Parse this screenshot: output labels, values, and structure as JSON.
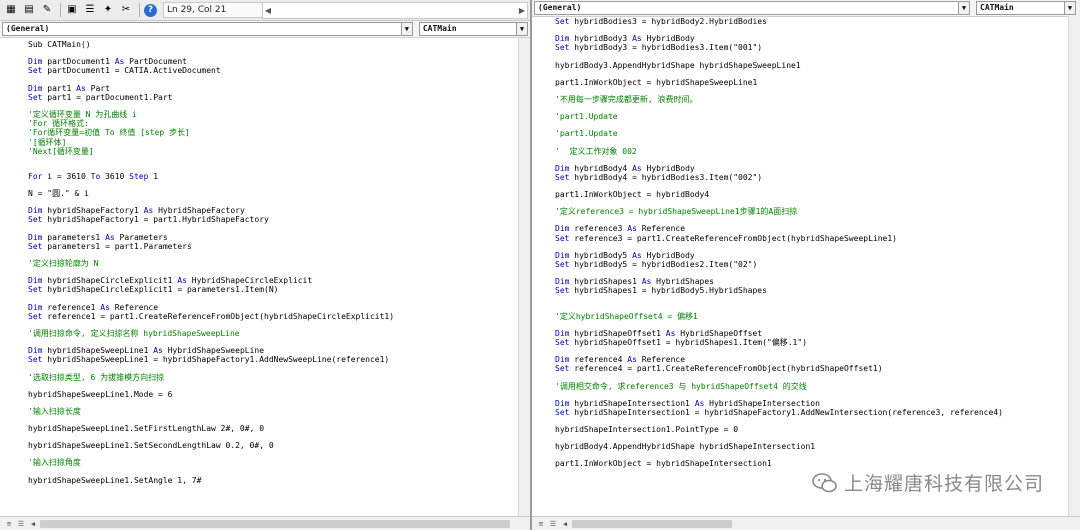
{
  "left": {
    "toolbar": {
      "position": "Ln 29, Col 21"
    },
    "object_combo": "(General)",
    "proc_combo": "CATMain",
    "lines": [
      [
        {
          "t": "Sub CATMain()"
        }
      ],
      [],
      [
        {
          "t": "Dim",
          "c": "kw"
        },
        {
          "t": " partDocument1 "
        },
        {
          "t": "As",
          "c": "kw"
        },
        {
          "t": " PartDocument"
        }
      ],
      [
        {
          "t": "Set",
          "c": "kw"
        },
        {
          "t": " partDocument1 = CATIA.ActiveDocument"
        }
      ],
      [],
      [
        {
          "t": "Dim",
          "c": "kw"
        },
        {
          "t": " part1 "
        },
        {
          "t": "As",
          "c": "kw"
        },
        {
          "t": " Part"
        }
      ],
      [
        {
          "t": "Set",
          "c": "kw"
        },
        {
          "t": " part1 = partDocument1.Part"
        }
      ],
      [],
      [
        {
          "t": "'定义循环变量 N 为孔曲线 i",
          "c": "cm"
        }
      ],
      [
        {
          "t": "'For 循环格式:",
          "c": "cm"
        }
      ],
      [
        {
          "t": "'For循环变量=初值 To 终值 [step 步长]",
          "c": "cm"
        }
      ],
      [
        {
          "t": "'[循环体]",
          "c": "cm"
        }
      ],
      [
        {
          "t": "'Next[循环变量]",
          "c": "cm"
        }
      ],
      [],
      [],
      [
        {
          "t": "For",
          "c": "kw"
        },
        {
          "t": " i = 3610 "
        },
        {
          "t": "To",
          "c": "kw"
        },
        {
          "t": " 3610 "
        },
        {
          "t": "Step",
          "c": "kw"
        },
        {
          "t": " 1"
        }
      ],
      [],
      [
        {
          "t": "N = \"圆.\" & i"
        }
      ],
      [],
      [
        {
          "t": "Dim",
          "c": "kw"
        },
        {
          "t": " hybridShapeFactory1 "
        },
        {
          "t": "As",
          "c": "kw"
        },
        {
          "t": " HybridShapeFactory"
        }
      ],
      [
        {
          "t": "Set",
          "c": "kw"
        },
        {
          "t": " hybridShapeFactory1 = part1.HybridShapeFactory"
        }
      ],
      [],
      [
        {
          "t": "Dim",
          "c": "kw"
        },
        {
          "t": " parameters1 "
        },
        {
          "t": "As",
          "c": "kw"
        },
        {
          "t": " Parameters"
        }
      ],
      [
        {
          "t": "Set",
          "c": "kw"
        },
        {
          "t": " parameters1 = part1.Parameters"
        }
      ],
      [],
      [
        {
          "t": "'定义扫掠轮廓为 N",
          "c": "cm"
        }
      ],
      [],
      [
        {
          "t": "Dim",
          "c": "kw"
        },
        {
          "t": " hybridShapeCircleExplicit1 "
        },
        {
          "t": "As",
          "c": "kw"
        },
        {
          "t": " HybridShapeCircleExplicit"
        }
      ],
      [
        {
          "t": "Set",
          "c": "kw"
        },
        {
          "t": " hybridShapeCircleExplicit1 = parameters1.Item(N)"
        }
      ],
      [],
      [
        {
          "t": "Dim",
          "c": "kw"
        },
        {
          "t": " reference1 "
        },
        {
          "t": "As",
          "c": "kw"
        },
        {
          "t": " Reference"
        }
      ],
      [
        {
          "t": "Set",
          "c": "kw"
        },
        {
          "t": " reference1 = part1.CreateReferenceFromObject(hybridShapeCircleExplicit1)"
        }
      ],
      [],
      [
        {
          "t": "'调用扫掠命令, 定义扫掠名称 hybridShapeSweepLine",
          "c": "cm"
        }
      ],
      [],
      [
        {
          "t": "Dim",
          "c": "kw"
        },
        {
          "t": " hybridShapeSweepLine1 "
        },
        {
          "t": "As",
          "c": "kw"
        },
        {
          "t": " HybridShapeSweepLine"
        }
      ],
      [
        {
          "t": "Set",
          "c": "kw"
        },
        {
          "t": " hybridShapeSweepLine1 = hybridShapeFactory1.AddNewSweepLine(reference1)"
        }
      ],
      [],
      [
        {
          "t": "'选取扫掠类型, 6 为拔锥模方向扫掠",
          "c": "cm"
        }
      ],
      [],
      [
        {
          "t": "hybridShapeSweepLine1.Mode = 6"
        }
      ],
      [],
      [
        {
          "t": "'输入扫掠长度",
          "c": "cm"
        }
      ],
      [],
      [
        {
          "t": "hybridShapeSweepLine1.SetFirstLengthLaw 2#, 0#, 0"
        }
      ],
      [],
      [
        {
          "t": "hybridShapeSweepLine1.SetSecondLengthLaw 0.2, 0#, 0"
        }
      ],
      [],
      [
        {
          "t": "'输入扫掠角度",
          "c": "cm"
        }
      ],
      [],
      [
        {
          "t": "hybridShapeSweepLine1.SetAngle 1, 7#"
        }
      ]
    ]
  },
  "right": {
    "object_combo": "(General)",
    "proc_combo": "CATMain",
    "lines": [
      [
        {
          "t": "Set",
          "c": "kw"
        },
        {
          "t": " hybridBodies3 = hybridBody2.HybridBodies"
        }
      ],
      [],
      [
        {
          "t": "Dim",
          "c": "kw"
        },
        {
          "t": " hybridBody3 "
        },
        {
          "t": "As",
          "c": "kw"
        },
        {
          "t": " HybridBody"
        }
      ],
      [
        {
          "t": "Set",
          "c": "kw"
        },
        {
          "t": " hybridBody3 = hybridBodies3.Item(\"001\")"
        }
      ],
      [],
      [
        {
          "t": "hybridBody3.AppendHybridShape hybridShapeSweepLine1"
        }
      ],
      [],
      [
        {
          "t": "part1.InWorkObject = hybridShapeSweepLine1"
        }
      ],
      [],
      [
        {
          "t": "'不用每一步骤完成都更新, 浪费时间。",
          "c": "cm"
        }
      ],
      [],
      [
        {
          "t": "'part1.Update",
          "c": "cm"
        }
      ],
      [],
      [
        {
          "t": "'part1.Update",
          "c": "cm"
        }
      ],
      [],
      [
        {
          "t": "'  定义工作对象 002",
          "c": "cm"
        }
      ],
      [],
      [
        {
          "t": "Dim",
          "c": "kw"
        },
        {
          "t": " hybridBody4 "
        },
        {
          "t": "As",
          "c": "kw"
        },
        {
          "t": " HybridBody"
        }
      ],
      [
        {
          "t": "Set",
          "c": "kw"
        },
        {
          "t": " hybridBody4 = hybridBodies3.Item(\"002\")"
        }
      ],
      [],
      [
        {
          "t": "part1.InWorkObject = hybridBody4"
        }
      ],
      [],
      [
        {
          "t": "'定义reference3 = hybridShapeSweepLine1步骤1的A面扫掠",
          "c": "cm"
        }
      ],
      [],
      [
        {
          "t": "Dim",
          "c": "kw"
        },
        {
          "t": " reference3 "
        },
        {
          "t": "As",
          "c": "kw"
        },
        {
          "t": " Reference"
        }
      ],
      [
        {
          "t": "Set",
          "c": "kw"
        },
        {
          "t": " reference3 = part1.CreateReferenceFromObject(hybridShapeSweepLine1)"
        }
      ],
      [],
      [
        {
          "t": "Dim",
          "c": "kw"
        },
        {
          "t": " hybridBody5 "
        },
        {
          "t": "As",
          "c": "kw"
        },
        {
          "t": " HybridBody"
        }
      ],
      [
        {
          "t": "Set",
          "c": "kw"
        },
        {
          "t": " hybridBody5 = hybridBodies2.Item(\"02\")"
        }
      ],
      [],
      [
        {
          "t": "Dim",
          "c": "kw"
        },
        {
          "t": " hybridShapes1 "
        },
        {
          "t": "As",
          "c": "kw"
        },
        {
          "t": " HybridShapes"
        }
      ],
      [
        {
          "t": "Set",
          "c": "kw"
        },
        {
          "t": " hybridShapes1 = hybridBody5.HybridShapes"
        }
      ],
      [],
      [],
      [
        {
          "t": "'定义hybridShapeOffset4 = 偏移1",
          "c": "cm"
        }
      ],
      [],
      [
        {
          "t": "Dim",
          "c": "kw"
        },
        {
          "t": " hybridShapeOffset1 "
        },
        {
          "t": "As",
          "c": "kw"
        },
        {
          "t": " HybridShapeOffset"
        }
      ],
      [
        {
          "t": "Set",
          "c": "kw"
        },
        {
          "t": " hybridShapeOffset1 = hybridShapes1.Item(\"偏移.1\")"
        }
      ],
      [],
      [
        {
          "t": "Dim",
          "c": "kw"
        },
        {
          "t": " reference4 "
        },
        {
          "t": "As",
          "c": "kw"
        },
        {
          "t": " Reference"
        }
      ],
      [
        {
          "t": "Set",
          "c": "kw"
        },
        {
          "t": " reference4 = part1.CreateReferenceFromObject(hybridShapeOffset1)"
        }
      ],
      [],
      [
        {
          "t": "'调用相交命令, 求reference3 与 hybridShapeOffset4 的交线",
          "c": "cm"
        }
      ],
      [],
      [
        {
          "t": "Dim",
          "c": "kw"
        },
        {
          "t": " hybridShapeIntersection1 "
        },
        {
          "t": "As",
          "c": "kw"
        },
        {
          "t": " HybridShapeIntersection"
        }
      ],
      [
        {
          "t": "Set",
          "c": "kw"
        },
        {
          "t": " hybridShapeIntersection1 = hybridShapeFactory1.AddNewIntersection(reference3, reference4)"
        }
      ],
      [],
      [
        {
          "t": "hybridShapeIntersection1.PointType = 0"
        }
      ],
      [],
      [
        {
          "t": "hybridBody4.AppendHybridShape hybridShapeIntersection1"
        }
      ],
      [],
      [
        {
          "t": "part1.InWorkObject = hybridShapeIntersection1"
        }
      ]
    ]
  },
  "watermark": "上海耀唐科技有限公司",
  "colors": {
    "keyword": "#0000b0",
    "comment": "#008000",
    "text": "#000000"
  },
  "icons": [
    "view-object-icon",
    "view-code-icon",
    "design-mode-icon",
    "project-explorer-icon",
    "properties-icon",
    "object-browser-icon",
    "toolbox-icon",
    "help-icon"
  ]
}
